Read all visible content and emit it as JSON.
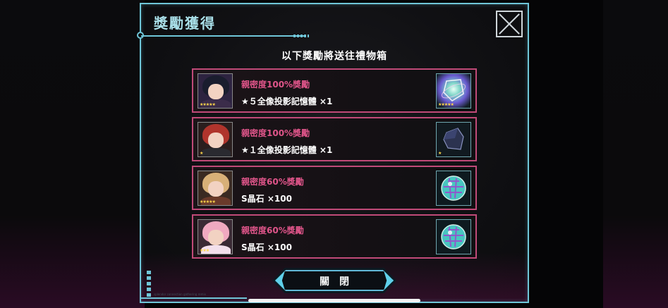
{
  "dialog": {
    "title": "獎勵獲得",
    "subtitle": "以下獎勵將送往禮物箱",
    "close_button_label": "關閉",
    "close_icon": "close-icon",
    "footer_small_text": "splendor connection gathering remix"
  },
  "rewards": [
    {
      "title": "親密度100%獎勵",
      "description": "★５全像投影記憶體 ×1",
      "char_stars": "★★★★★",
      "item_stars": "★★★★★",
      "item_icon": "hologram-memory-5-icon",
      "hair_color": "#1a1d2e",
      "body_color": "#3b2c4a",
      "accent": "#8b4fd0"
    },
    {
      "title": "親密度100%獎勵",
      "description": "★１全像投影記憶體 ×1",
      "char_stars": "★",
      "item_stars": "★",
      "item_icon": "hologram-memory-1-icon",
      "hair_color": "#b0342c",
      "body_color": "#2a2a30",
      "accent": "#2c8a4a"
    },
    {
      "title": "親密度60%獎勵",
      "description": "S晶石 ×100",
      "char_stars": "★★★★★",
      "item_stars": "",
      "item_icon": "s-crystal-icon",
      "hair_color": "#d8b078",
      "body_color": "#6a3a2a",
      "accent": "#4a7ad0"
    },
    {
      "title": "親密度60%獎勵",
      "description": "S晶石 ×100",
      "char_stars": "★★★",
      "item_stars": "",
      "item_icon": "s-crystal-icon",
      "hair_color": "#f0a9c0",
      "body_color": "#f3e0ec",
      "accent": "#3fae6a"
    }
  ]
}
